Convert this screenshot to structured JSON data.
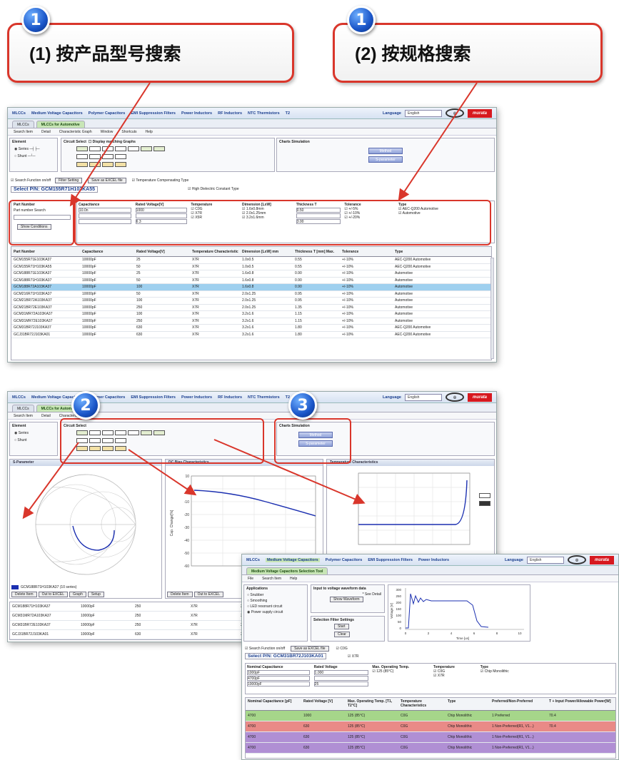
{
  "callouts": [
    {
      "badge": "1",
      "text": "(1) 按产品型号搜索"
    },
    {
      "badge": "1",
      "text": "(2) 按规格搜索"
    },
    {
      "badge": "2"
    },
    {
      "badge": "3"
    }
  ],
  "colors": {
    "callout_border": "#d9362b",
    "badge": "#1a55c8",
    "selected_row": "#9fd0ef",
    "murata_red": "#d7191f"
  },
  "shot1": {
    "nav_items": [
      "MLCCs",
      "Medium Voltage Capacitors",
      "Polymer Capacitors",
      "EMI Suppression Filters",
      "Power Inductors",
      "RF Inductors",
      "NTC Thermistors",
      "T2"
    ],
    "language_label": "Language",
    "language_value": "English",
    "tabs": [
      "MLCCs",
      "MLCCs for Automotive"
    ],
    "menu": [
      "Search Item",
      "Detail",
      "Characteristic Graph",
      "Window",
      "Shortcuts",
      "Help"
    ],
    "panels": {
      "element": "Element",
      "circuit": "Circuit Select",
      "chart": "Charts Simulation"
    },
    "radios": [
      "Series",
      "Shunt"
    ],
    "circuit_opts": [
      "Display matching Graphs"
    ],
    "chart_buttons": [
      "Method",
      "S-parameter"
    ],
    "toolbar_check": "Search Function on/off",
    "toolbar_btn1": "Filter Setting",
    "toolbar_btn2": "Save as EXCEL file",
    "toolbar_checks": [
      "Temperature Compensating Type",
      "High Dielectric Constant Type"
    ],
    "select_pn": "Select P/N: GCM155R71H103KA55",
    "filters": {
      "part_number": {
        "label": "Part Number",
        "hint": "Part number Search",
        "button": "Show Conditions"
      },
      "columns": [
        {
          "title": "Capacitance",
          "values": [
            "10.0n"
          ]
        },
        {
          "title": "Rated Voltage[V]",
          "values": [
            "1000",
            "6.3"
          ]
        },
        {
          "title": "Temperature",
          "values": [
            "C0G",
            "X7R",
            "X5R"
          ]
        },
        {
          "title": "Dimension [LxW]",
          "values": [
            "1.6x0.8mm",
            "2.0x1.25mm",
            "3.2x1.6mm"
          ]
        },
        {
          "title": "Thickness T",
          "values": [
            "0.50",
            "3.00"
          ]
        },
        {
          "title": "Tolerance",
          "values": [
            "+/-5%",
            "+/-10%",
            "+/-20%"
          ]
        },
        {
          "title": "Type",
          "values": [
            "AEC-Q200 Automotive",
            "Automotive"
          ]
        }
      ]
    },
    "columns": [
      "Part Number",
      "Capacitance",
      "Rated Voltage[V]",
      "Temperature Characteristic",
      "Dimension [LxW] mm",
      "Thickness T [mm] Max.",
      "Tolerance",
      "Type"
    ],
    "rows": [
      [
        "GCM155R71E103KA37",
        "10000pF",
        "25",
        "X7R",
        "1.0x0.5",
        "0.55",
        "+/-10%",
        "AEC-Q200 Automotive"
      ],
      [
        "GCM155R71H103KA55",
        "10000pF",
        "50",
        "X7R",
        "1.0x0.5",
        "0.55",
        "+/-10%",
        "AEC-Q200 Automotive"
      ],
      [
        "GCM188R71E103KA37",
        "10000pF",
        "25",
        "X7R",
        "1.6x0.8",
        "0.90",
        "+/-10%",
        "Automotive"
      ],
      [
        "GCM188R71H103KA37",
        "10000pF",
        "50",
        "X7R",
        "1.6x0.8",
        "0.90",
        "+/-10%",
        "Automotive"
      ],
      [
        "GCM188R72A103KA37",
        "10000pF",
        "100",
        "X7R",
        "1.6x0.8",
        "0.90",
        "+/-10%",
        "Automotive"
      ],
      [
        "GCM216R71H103KA37",
        "10000pF",
        "50",
        "X7R",
        "2.0x1.25",
        "0.95",
        "+/-10%",
        "Automotive"
      ],
      [
        "GCM21BR72A103KA37",
        "10000pF",
        "100",
        "X7R",
        "2.0x1.25",
        "0.95",
        "+/-10%",
        "Automotive"
      ],
      [
        "GCM21BR72E103KA37",
        "10000pF",
        "250",
        "X7R",
        "2.0x1.25",
        "1.35",
        "+/-10%",
        "Automotive"
      ],
      [
        "GCM31MR72A103KA37",
        "10000pF",
        "100",
        "X7R",
        "3.2x1.6",
        "1.15",
        "+/-10%",
        "Automotive"
      ],
      [
        "GCM31MR72E103KA37",
        "10000pF",
        "250",
        "X7R",
        "3.2x1.6",
        "1.15",
        "+/-10%",
        "Automotive"
      ],
      [
        "GCM31BR72J103KA37",
        "10000pF",
        "630",
        "X7R",
        "3.2x1.6",
        "1.80",
        "+/-10%",
        "AEC-Q200 Automotive"
      ],
      [
        "GCJ31BR72J103KA01",
        "10000pF",
        "630",
        "X7R",
        "3.2x1.6",
        "1.80",
        "+/-10%",
        "AEC-Q200 Automotive"
      ]
    ],
    "selected_index": 4
  },
  "shot2": {
    "graph_titles": [
      "S-Parameter",
      "DC Bias Characteristics",
      "Temperature Characteristics"
    ],
    "y_label": "Cap. Change[%]",
    "legend": "GCM188R71H103KA37 (10 series)",
    "buttons": [
      "Delete Item",
      "Out to EXCEL",
      "Graph",
      "Setup"
    ],
    "y_ticks": [
      "10",
      "0",
      "-10",
      "-20",
      "-30",
      "-40",
      "-50",
      "-60"
    ],
    "rows": [
      [
        "GCM188R71H103KA37",
        "10000pF",
        "250",
        "X7R",
        "2.0x1.25"
      ],
      [
        "GCM31MR72A103KA37",
        "10000pF",
        "250",
        "X7R",
        "3.2x1.6"
      ],
      [
        "GCM31BR72E103KA37",
        "10000pF",
        "250",
        "X7R",
        "3.2x1.6"
      ],
      [
        "GCJ31BR72J103KA01",
        "10000pF",
        "630",
        "X7R",
        "3.2x1.6"
      ]
    ]
  },
  "shot3": {
    "nav_items": [
      "MLCCs",
      "Medium Voltage Capacitors",
      "Polymer Capacitors",
      "EMI Suppression Filters",
      "Power Inductors"
    ],
    "language_label": "Language",
    "language_value": "English",
    "title": "Medium Voltage Capacitors Selection Tool",
    "menu": [
      "File",
      "Search Item",
      "Help"
    ],
    "applications": {
      "title": "Applications",
      "items": [
        "Snubber",
        "Smoothing",
        "LED resonant circuit",
        "Power supply circuit"
      ]
    },
    "voltage_box": {
      "title": "Input to voltage waveform data",
      "note": "* See Detail",
      "button": "Show Waveform"
    },
    "sel_box": {
      "title": "Selection Filter Settings",
      "buttons": [
        "Start",
        "Clear"
      ]
    },
    "chart_ylabel": "Voltage [V]",
    "chart_xlabel": "Time [us]",
    "chart_yticks": [
      "300",
      "250",
      "200",
      "150",
      "100",
      "50",
      "0"
    ],
    "chart_xticks": [
      "0",
      "2",
      "4",
      "6",
      "8",
      "10"
    ],
    "toolbar_check": "Search Function on/off",
    "save_btn": "Save as EXCEL file",
    "checks": [
      "C0G",
      "X7R"
    ],
    "select_pn": "Select P/N: GCM31BR72J103KA01",
    "filter_titles": [
      "Nominal Capacitance",
      "Rated Voltage",
      "Max. Operating Temp.",
      "Temperature",
      "Type"
    ],
    "filter_values": [
      [
        "1000pF",
        "4700pF",
        "10000pF"
      ],
      [
        "1.000",
        "25"
      ],
      [
        "125 (85°C)"
      ],
      [
        "C0G",
        "X7R"
      ],
      [
        "Chip Monolithic"
      ]
    ],
    "columns": [
      "Nominal Capacitance [pF]",
      "Rated Voltage [V]",
      "Max. Operating Temp. [T1, T2°C]",
      "Temperature Characteristics",
      "Type",
      "Preferred/Non-Preferred",
      "T + Input Power/Allowable Power[W]"
    ],
    "rows": [
      [
        "4700",
        "1000",
        "125 (85°C)",
        "C0G",
        "Chip Monolithic",
        "1 Preferred",
        "70.4"
      ],
      [
        "4700",
        "630",
        "125 (85°C)",
        "C0G",
        "Chip Monolithic",
        "1 Non-Preferred(R1, V1...)",
        "70.4"
      ],
      [
        "4700",
        "630",
        "125 (85°C)",
        "C0G",
        "Chip Monolithic",
        "1 Non-Preferred(R1, V1...)",
        ""
      ],
      [
        "4700",
        "630",
        "125 (85°C)",
        "C0G",
        "Chip Monolithic",
        "1 Non-Preferred(R1, V1...)",
        ""
      ]
    ],
    "row_colors": [
      "#a6d68a",
      "#e98a87",
      "#b08fd4",
      "#b08fd4"
    ]
  }
}
